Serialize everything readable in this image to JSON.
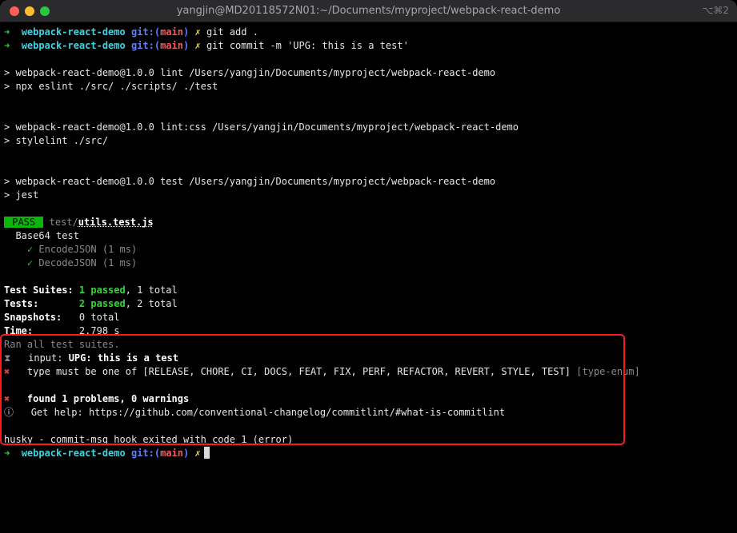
{
  "window": {
    "title": "yangjin@MD20118572N01:~/Documents/myproject/webpack-react-demo",
    "shortcut": "⌥⌘2"
  },
  "prompt": {
    "arrow": "➜",
    "dir": "webpack-react-demo",
    "git": "git:(",
    "branch": "main",
    "git_close": ")",
    "dirty": "✗"
  },
  "commands": {
    "git_add": "git add .",
    "git_commit": "git commit -m 'UPG: this is a test'"
  },
  "output": {
    "lint_header": "> webpack-react-demo@1.0.0 lint /Users/yangjin/Documents/myproject/webpack-react-demo",
    "lint_cmd": "> npx eslint ./src/ ./scripts/ ./test",
    "lintcss_header": "> webpack-react-demo@1.0.0 lint:css /Users/yangjin/Documents/myproject/webpack-react-demo",
    "lintcss_cmd": "> stylelint ./src/",
    "test_header": "> webpack-react-demo@1.0.0 test /Users/yangjin/Documents/myproject/webpack-react-demo",
    "test_cmd": "> jest",
    "pass_badge": " PASS ",
    "test_dir": "test/",
    "test_file": "utils.test.js",
    "suite_name": "Base64 test",
    "check": "✓",
    "test1": "EncodeJSON (1 ms)",
    "test2": "DecodeJSON (1 ms)",
    "suites_label": "Test Suites: ",
    "suites_passed": "1 passed",
    "suites_total": ", 1 total",
    "tests_label": "Tests:       ",
    "tests_passed": "2 passed",
    "tests_total": ", 2 total",
    "snapshots_label": "Snapshots:   ",
    "snapshots_value": "0 total",
    "time_label": "Time:        ",
    "time_value": "2.798 s",
    "ran_all": "Ran all test suites."
  },
  "commitlint": {
    "input_icon": "⧗",
    "input_label": "input: ",
    "input_value": "UPG: this is a test",
    "error_icon": "✖",
    "error_msg": "type must be one of [RELEASE, CHORE, CI, DOCS, FEAT, FIX, PERF, REFACTOR, REVERT, STYLE, TEST]",
    "error_rule": "[type-enum]",
    "summary_icon": "✖",
    "summary": "found 1 problems, 0 warnings",
    "help_icon": "ⓘ",
    "help": "Get help: https://github.com/conventional-changelog/commitlint/#what-is-commitlint",
    "husky": "husky - commit-msg hook exited with code 1 (error)"
  }
}
